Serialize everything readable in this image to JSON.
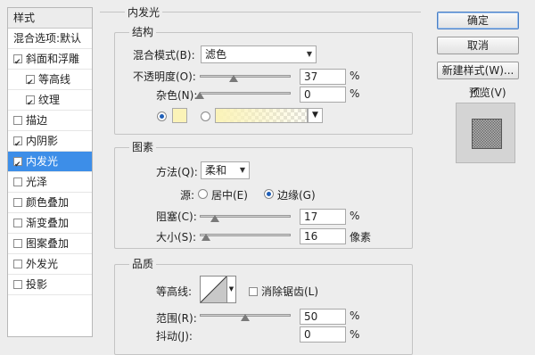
{
  "styles_panel": {
    "header": "样式",
    "blend_options": "混合选项:默认",
    "items": [
      {
        "label": "斜面和浮雕",
        "checked": true,
        "sub": false,
        "selected": false
      },
      {
        "label": "等高线",
        "checked": true,
        "sub": true,
        "selected": false
      },
      {
        "label": "纹理",
        "checked": true,
        "sub": true,
        "selected": false
      },
      {
        "label": "描边",
        "checked": false,
        "sub": false,
        "selected": false
      },
      {
        "label": "内阴影",
        "checked": true,
        "sub": false,
        "selected": false
      },
      {
        "label": "内发光",
        "checked": true,
        "sub": false,
        "selected": true
      },
      {
        "label": "光泽",
        "checked": false,
        "sub": false,
        "selected": false
      },
      {
        "label": "颜色叠加",
        "checked": false,
        "sub": false,
        "selected": false
      },
      {
        "label": "渐变叠加",
        "checked": false,
        "sub": false,
        "selected": false
      },
      {
        "label": "图案叠加",
        "checked": false,
        "sub": false,
        "selected": false
      },
      {
        "label": "外发光",
        "checked": false,
        "sub": false,
        "selected": false
      },
      {
        "label": "投影",
        "checked": false,
        "sub": false,
        "selected": false
      }
    ]
  },
  "panel_title": "内发光",
  "structure": {
    "title": "结构",
    "blend_mode_label": "混合模式(B):",
    "blend_mode_value": "滤色",
    "opacity_label": "不透明度(O):",
    "opacity_value": "37",
    "opacity_unit": "%",
    "opacity_fraction": 0.37,
    "noise_label": "杂色(N):",
    "noise_value": "0",
    "noise_unit": "%",
    "noise_fraction": 0.0,
    "glow_color": "#fbf3b8"
  },
  "elements": {
    "title": "图素",
    "technique_label": "方法(Q):",
    "technique_value": "柔和",
    "source_label": "源:",
    "source_center": "居中(E)",
    "source_edge": "边缘(G)",
    "choke_label": "阻塞(C):",
    "choke_value": "17",
    "choke_unit": "%",
    "choke_fraction": 0.17,
    "size_label": "大小(S):",
    "size_value": "16",
    "size_unit": "像素",
    "size_fraction": 0.064
  },
  "quality": {
    "title": "品质",
    "contour_label": "等高线:",
    "antialias_label": "消除锯齿(L)",
    "range_label": "范围(R):",
    "range_value": "50",
    "range_unit": "%",
    "range_fraction": 0.5,
    "jitter_label": "抖动(J):",
    "jitter_value": "0",
    "jitter_unit": "%"
  },
  "buttons": {
    "ok": "确定",
    "cancel": "取消",
    "new_style": "新建样式(W)...",
    "preview_label": "预览(V)",
    "preview_checked": true
  }
}
